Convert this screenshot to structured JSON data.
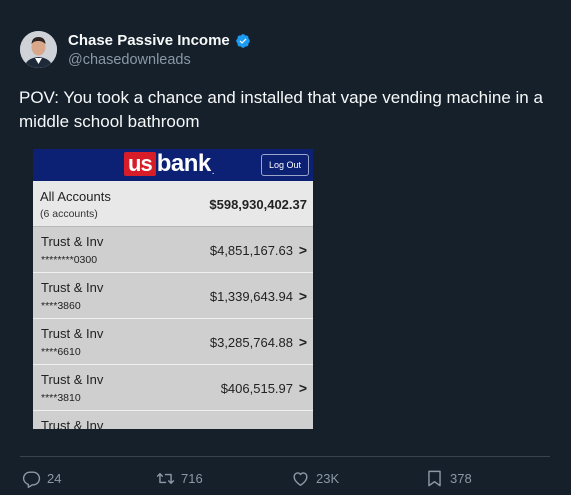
{
  "author": {
    "display_name": "Chase Passive Income",
    "handle": "@chasedownleads",
    "verified_icon": "verified-badge-icon",
    "verified_color": "#1d9bf0"
  },
  "tweet": {
    "text": "POV: You took a chance and installed that vape vending machine in a middle school bathroom"
  },
  "media": {
    "bank_logo_box": "us",
    "bank_logo_text": "bank",
    "bank_logo_dot": ".",
    "logout_label": "Log Out",
    "all_accounts": {
      "title": "All Accounts",
      "count": "(6 accounts)",
      "total": "$598,930,402.37"
    },
    "accounts": [
      {
        "name": "Trust & Inv",
        "number": "********0300",
        "balance": "$4,851,167.63",
        "chevron": ">"
      },
      {
        "name": "Trust & Inv",
        "number": "****3860",
        "balance": "$1,339,643.94",
        "chevron": ">"
      },
      {
        "name": "Trust & Inv",
        "number": "****6610",
        "balance": "$3,285,764.88",
        "chevron": ">"
      },
      {
        "name": "Trust & Inv",
        "number": "****3810",
        "balance": "$406,515.97",
        "chevron": ">"
      },
      {
        "name": "Trust & Inv",
        "number": "",
        "balance": "",
        "chevron": ""
      }
    ],
    "colors": {
      "header_bg": "#0c2074",
      "logo_red": "#d71e28"
    }
  },
  "actions": {
    "replies": "24",
    "retweets": "716",
    "likes": "23K",
    "bookmarks": "378"
  }
}
